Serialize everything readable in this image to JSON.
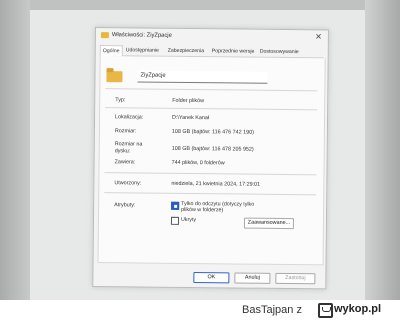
{
  "window": {
    "title": "Właściwości: ZiyZpacje",
    "close_glyph": "✕"
  },
  "tabs": [
    {
      "label": "Ogólne",
      "active": true
    },
    {
      "label": "Udostępnianie",
      "active": false
    },
    {
      "label": "Zabezpieczenia",
      "active": false
    },
    {
      "label": "Poprzednie wersje",
      "active": false
    },
    {
      "label": "Dostosowywanie",
      "active": false
    }
  ],
  "folder": {
    "name": "ZiyZpacje",
    "icon": "folder-icon"
  },
  "properties": {
    "typ_label": "Typ:",
    "typ_value": "Folder plików",
    "lokalizacja_label": "Lokalizacja:",
    "lokalizacja_value": "D:\\Yanek Kanał",
    "rozmiar_label": "Rozmiar:",
    "rozmiar_value": "108 GB (bajtów: 116 476 742 190)",
    "rozmiar_dysku_label": "Rozmiar na dysku:",
    "rozmiar_dysku_value": "108 GB (bajtów: 116 478 205 952)",
    "zawiera_label": "Zawiera:",
    "zawiera_value": "744 plików, 0 folderów",
    "utworzony_label": "Utworzony:",
    "utworzony_value": "niedziela, 21 kwietnia 2024, 17:29:01"
  },
  "attributes": {
    "label": "Atrybuty:",
    "readonly_label": "Tylko do odczytu (dotyczy tylko plików w folderze)",
    "readonly_checked": true,
    "hidden_label": "Ukryty",
    "hidden_checked": false,
    "advanced_button": "Zaawansowane..."
  },
  "buttons": {
    "ok": "OK",
    "cancel": "Anuluj",
    "apply": "Zastosuj"
  },
  "footer": {
    "user": "BasTajpan",
    "conj": "z",
    "site": "wykop.pl"
  },
  "colors": {
    "accent": "#2f66c8",
    "folder": "#eab646"
  }
}
